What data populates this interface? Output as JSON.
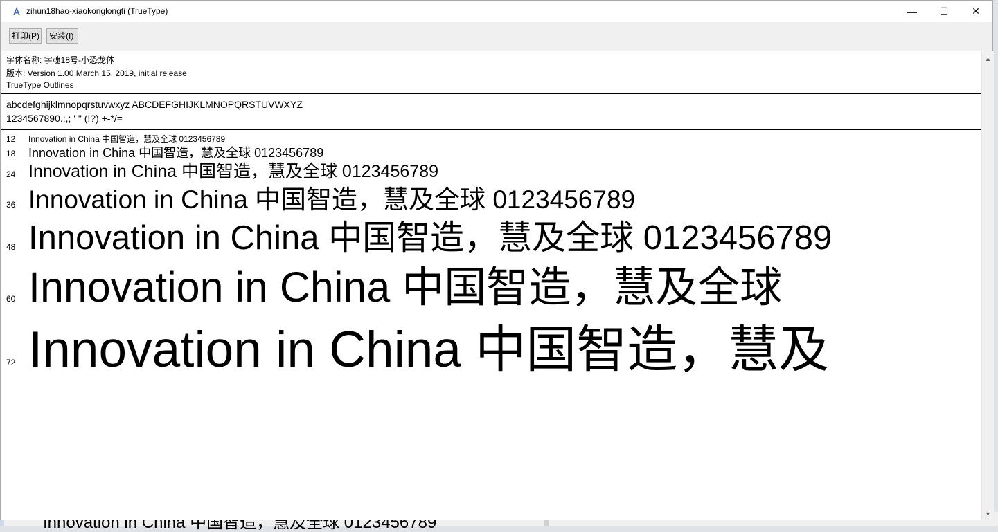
{
  "window": {
    "title": "zihun18hao-xiaokonglongti (TrueType)",
    "controls": {
      "minimize": "—",
      "maximize": "☐",
      "close": "✕"
    }
  },
  "toolbar": {
    "print_label": "打印(P)",
    "install_label": "安装(I)"
  },
  "info": {
    "font_name": "字体名称: 字魂18号-小恐龙体",
    "version": "版本: Version 1.00 March 15, 2019, initial release",
    "outlines": "TrueType Outlines"
  },
  "charset": {
    "line1": "abcdefghijklmnopqrstuvwxyz   ABCDEFGHIJKLMNOPQRSTUVWXYZ",
    "line2": "1234567890.:,;  '  \"  (!?)   +-*/="
  },
  "samples": [
    {
      "size": "12",
      "text": "Innovation   in   China   中国智造，慧及全球   0123456789"
    },
    {
      "size": "18",
      "text": "Innovation   in   China   中国智造，慧及全球   0123456789"
    },
    {
      "size": "24",
      "text": "Innovation   in   China   中国智造，慧及全球   0123456789"
    },
    {
      "size": "36",
      "text": "Innovation   in   China   中国智造，慧及全球   0123456789"
    },
    {
      "size": "48",
      "text": "Innovation   in   China   中国智造，慧及全球   0123456789"
    },
    {
      "size": "60",
      "text": "Innovation   in   China   中国智造，慧及全球"
    },
    {
      "size": "72",
      "text": "Innovation   in   China   中国智造，慧及"
    }
  ],
  "background": {
    "text": "Innovation in China 中国智造，慧及全球 0123456789"
  },
  "scrollbar": {
    "up": "▲",
    "down": "▼"
  },
  "icons": {
    "app": "font-file-icon"
  }
}
